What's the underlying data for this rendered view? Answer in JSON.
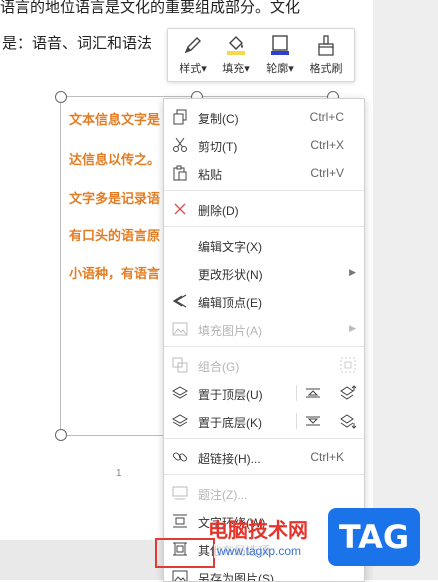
{
  "document": {
    "top_text": "语言的地位语言是文化的重要组成部分。文化",
    "intro_line": "是：语音、词汇和语法",
    "textbox_lines": [
      "文本信息文字是",
      "达信息以传之。",
      "文字多是记录语",
      "有口头的语言原",
      "小语种，有语言"
    ],
    "page_number": "1"
  },
  "toolbar": {
    "style": "样式",
    "fill": "填充",
    "outline": "轮廓",
    "format_brush": "格式刷"
  },
  "menu": {
    "copy": {
      "label": "复制(C)",
      "shortcut": "Ctrl+C"
    },
    "cut": {
      "label": "剪切(T)",
      "shortcut": "Ctrl+X"
    },
    "paste": {
      "label": "粘贴",
      "shortcut": "Ctrl+V"
    },
    "delete": {
      "label": "删除(D)"
    },
    "edit_text": {
      "label": "编辑文字(X)"
    },
    "change_shape": {
      "label": "更改形状(N)"
    },
    "edit_points": {
      "label": "编辑顶点(E)"
    },
    "fill_image": {
      "label": "填充图片(A)"
    },
    "group": {
      "label": "组合(G)"
    },
    "bring_to_front": {
      "label": "置于顶层(U)"
    },
    "send_to_back": {
      "label": "置于底层(K)"
    },
    "hyperlink": {
      "label": "超链接(H)...",
      "shortcut": "Ctrl+K"
    },
    "caption": {
      "label": "题注(Z)..."
    },
    "text_wrap": {
      "label": "文字环绕(W)"
    },
    "other_layout": {
      "label": "其他布局选项"
    },
    "save_as_picture": {
      "label": "另存为图片(S)..."
    }
  },
  "watermark": {
    "site_name": "电脑技术网",
    "url": "www.tagxp.com",
    "logo": "TAG"
  },
  "colors": {
    "text_orange": "#e37d23",
    "selection_red": "#e53935",
    "watermark_red": "#e8332a",
    "logo_blue": "#1a73e8",
    "outline_blue": "#2b3fd1",
    "fill_yellow": "#f5d94a"
  }
}
